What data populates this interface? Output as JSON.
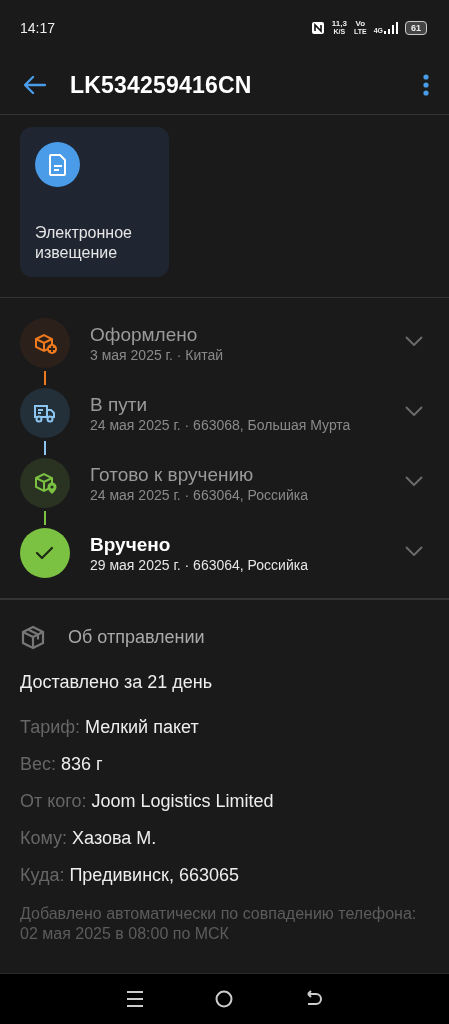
{
  "status_bar": {
    "time": "14:17",
    "speed": "11,3",
    "speed_unit": "K/S",
    "volte_top": "Vo",
    "volte_bottom": "LTE",
    "network": "4G",
    "battery": "61"
  },
  "header": {
    "title": "LK534259416CN"
  },
  "documents": [
    {
      "label": "Электронное извещение"
    }
  ],
  "timeline": [
    {
      "kind": "created",
      "title": "Оформлено",
      "subtitle": "3 мая 2025 г. · Китай",
      "current": false,
      "color": "#f07a1e"
    },
    {
      "kind": "transit",
      "title": "В пути",
      "subtitle": "24 мая 2025 г. · 663068, Большая Мурта",
      "current": false,
      "color": "#8cc6f0"
    },
    {
      "kind": "ready",
      "title": "Готово к вручению",
      "subtitle": "24 мая 2025 г. · 663064, Российка",
      "current": false,
      "color": "#7cc242"
    },
    {
      "kind": "delivered",
      "title": "Вручено",
      "subtitle": "29 мая 2025 г. · 663064, Российка",
      "current": true,
      "color": "#7cc242"
    }
  ],
  "details": {
    "heading": "Об отправлении",
    "summary": "Доставлено за 21 день",
    "fields": [
      {
        "label": "Тариф:",
        "value": "Мелкий пакет"
      },
      {
        "label": "Вес:",
        "value": "836 г"
      },
      {
        "label": "От кого:",
        "value": "Joom Logistics Limited"
      },
      {
        "label": "Кому:",
        "value": "Хазова М."
      },
      {
        "label": "Куда:",
        "value": "Предивинск, 663065"
      }
    ],
    "note": "Добавлено автоматически по совпадению телефона: 02 мая 2025 в 08:00 по МСК"
  }
}
